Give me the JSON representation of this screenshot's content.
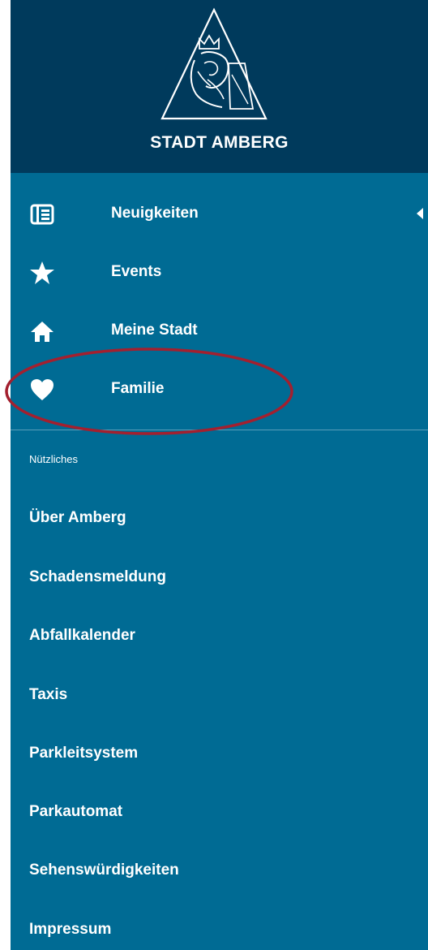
{
  "header": {
    "city_name": "STADT AMBERG",
    "logo_icon": "amberg-lion-triangle-logo"
  },
  "nav": {
    "items": [
      {
        "label": "Neuigkeiten",
        "icon": "news-icon",
        "expanded_indicator": "caret-left-icon"
      },
      {
        "label": "Events",
        "icon": "star-icon"
      },
      {
        "label": "Meine Stadt",
        "icon": "home-icon"
      },
      {
        "label": "Familie",
        "icon": "heart-icon"
      }
    ]
  },
  "section": {
    "title": "Nützliches",
    "items": [
      "Über Amberg",
      "Schadensmeldung",
      "Abfallkalender",
      "Taxis",
      "Parkleitsystem",
      "Parkautomat",
      "Sehenswürdigkeiten",
      "Impressum"
    ]
  },
  "colors": {
    "header_bg": "#003a5c",
    "drawer_bg": "#006b94",
    "text": "#ffffff",
    "highlight": "#a3202f"
  }
}
